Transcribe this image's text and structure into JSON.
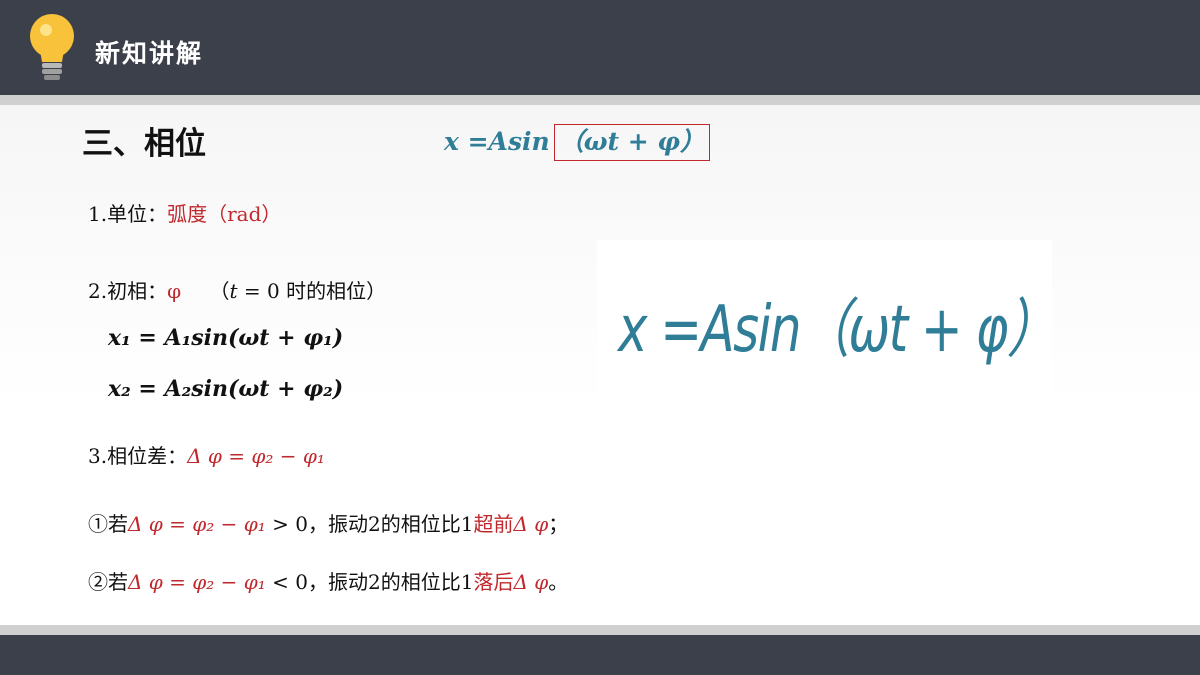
{
  "header": {
    "title": "新知讲解"
  },
  "section": {
    "title": "三、相位"
  },
  "formula_top": {
    "prefix": "x =Asin",
    "boxed": "（ωt + φ）"
  },
  "items": {
    "unit": {
      "label": "1.单位：",
      "value": "弧度（rad）"
    },
    "initial_phase": {
      "label": "2.初相：",
      "symbol": "φ",
      "note_open": "（",
      "note_t": "t",
      "note_rest": " = 0 时的相位）"
    },
    "eq1": "x₁ = A₁sin(ωt + φ₁)",
    "eq2": "x₂ = A₂sin(ωt + φ₂)",
    "diff": {
      "label": "3.相位差：",
      "expr": "Δ φ = φ₂ − φ₁"
    },
    "case1": {
      "prefix": "①若",
      "expr": "Δ φ = φ₂ − φ₁",
      "cond": " > 0，振动2的相位比1",
      "keyword": "超前",
      "suffix_expr": "Δ φ",
      "end": "；"
    },
    "case2": {
      "prefix": "②若",
      "expr": "Δ φ = φ₂ − φ₁",
      "cond": " < 0，振动2的相位比1",
      "keyword": "落后",
      "suffix_expr": "Δ φ",
      "end": "。"
    }
  },
  "big_formula": "x =Asin（ωt + φ）",
  "colors": {
    "header_bg": "#3c404a",
    "accent_red": "#c0282d",
    "formula_teal": "#2f7d96"
  },
  "icons": {
    "header": "lightbulb-icon"
  }
}
